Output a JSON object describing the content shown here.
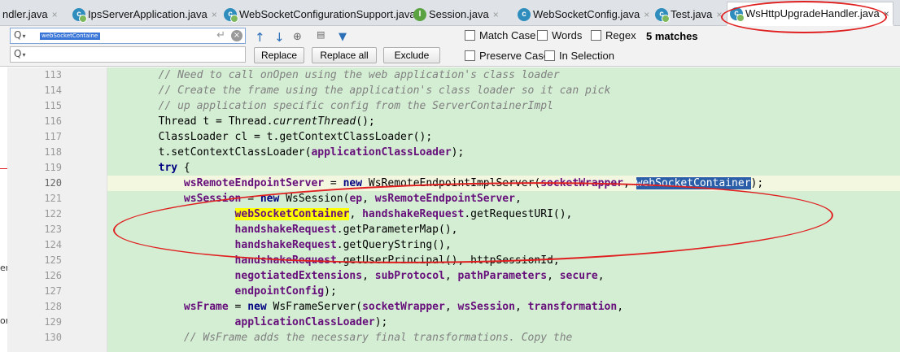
{
  "tabs": [
    {
      "label": "ndler.java",
      "icon": "class-icon",
      "active": false
    },
    {
      "label": "IpsServerApplication.java",
      "icon": "class-gear-icon",
      "active": false
    },
    {
      "label": "WebSocketConfigurationSupport.java",
      "icon": "class-gear-icon",
      "active": false
    },
    {
      "label": "Session.java",
      "icon": "interface-icon",
      "active": false
    },
    {
      "label": "WebSocketConfig.java",
      "icon": "class-icon",
      "active": false
    },
    {
      "label": "Test.java",
      "icon": "class-gear-icon",
      "active": false
    },
    {
      "label": "WsHttpUpgradeHandler.java",
      "icon": "class-gear-icon",
      "active": true
    }
  ],
  "find": {
    "query": "webSocketContainer",
    "replace_value": "",
    "replace_label": "Replace",
    "replace_all_label": "Replace all",
    "exclude_label": "Exclude",
    "match_case_label": "Match Case",
    "words_label": "Words",
    "regex_label": "Regex",
    "preserve_case_label": "Preserve Case",
    "in_selection_label": "In Selection",
    "match_count": "5 matches"
  },
  "left_fragments": [
    "erl",
    "on"
  ],
  "editor": {
    "current_line": 120,
    "lines": [
      {
        "num": 113,
        "html": "<span class='cmt'>        // Need to call onOpen using the web application's class loader</span>"
      },
      {
        "num": 114,
        "html": "<span class='cmt'>        // Create the frame using the application's class loader so it can pick</span>"
      },
      {
        "num": 115,
        "html": "<span class='cmt'>        // up application specific config from the ServerContainerImpl</span>"
      },
      {
        "num": 116,
        "html": "        Thread t = Thread.<span class='itl'>currentThread</span>();"
      },
      {
        "num": 117,
        "html": "        ClassLoader cl = t.getContextClassLoader();"
      },
      {
        "num": 118,
        "html": "        t.setContextClassLoader(<span class='fld'>applicationClassLoader</span>);"
      },
      {
        "num": 119,
        "html": "        <span class='kw'>try</span> {"
      },
      {
        "num": 120,
        "html": "            <span class='fld'>wsRemoteEndpointServer</span> = <span class='kw'>new</span> WsRemoteEndpointImplServer(<span class='fld'>socketWrapper</span>, <span class='sel'>webSocketContainer</span>);"
      },
      {
        "num": 121,
        "html": "            <span class='fld'>wsSession</span> = <span class='kw'>new</span> WsSession(<span class='fld'>ep</span>, <span class='fld'>wsRemoteEndpointServer</span>,"
      },
      {
        "num": 122,
        "html": "                    <span class='fld hl'>webSocketContainer</span>, <span class='fld'>handshakeRequest</span>.getRequestURI(),"
      },
      {
        "num": 123,
        "html": "                    <span class='fld'>handshakeRequest</span>.getParameterMap(),"
      },
      {
        "num": 124,
        "html": "                    <span class='fld'>handshakeRequest</span>.getQueryString(),"
      },
      {
        "num": 125,
        "html": "                    <span class='fld'>handshakeRequest</span>.getUserPrincipal(), httpSessionId,"
      },
      {
        "num": 126,
        "html": "                    <span class='fld'>negotiatedExtensions</span>, <span class='fld'>subProtocol</span>, <span class='fld'>pathParameters</span>, <span class='fld'>secure</span>,"
      },
      {
        "num": 127,
        "html": "                    <span class='fld'>endpointConfig</span>);"
      },
      {
        "num": 128,
        "html": "            <span class='fld'>wsFrame</span> = <span class='kw'>new</span> WsFrameServer(<span class='fld'>socketWrapper</span>, <span class='fld'>wsSession</span>, <span class='fld'>transformation</span>,"
      },
      {
        "num": 129,
        "html": "                    <span class='fld'>applicationClassLoader</span>);"
      },
      {
        "num": 130,
        "html": "<span class='cmt'>            // WsFrame adds the necessary final transformations. Copy the</span>"
      }
    ]
  },
  "colors": {
    "annotation": "#e02020",
    "code_background": "#d4eed4",
    "search_highlight": "#ffff00",
    "selection": "#2a5ea8"
  }
}
